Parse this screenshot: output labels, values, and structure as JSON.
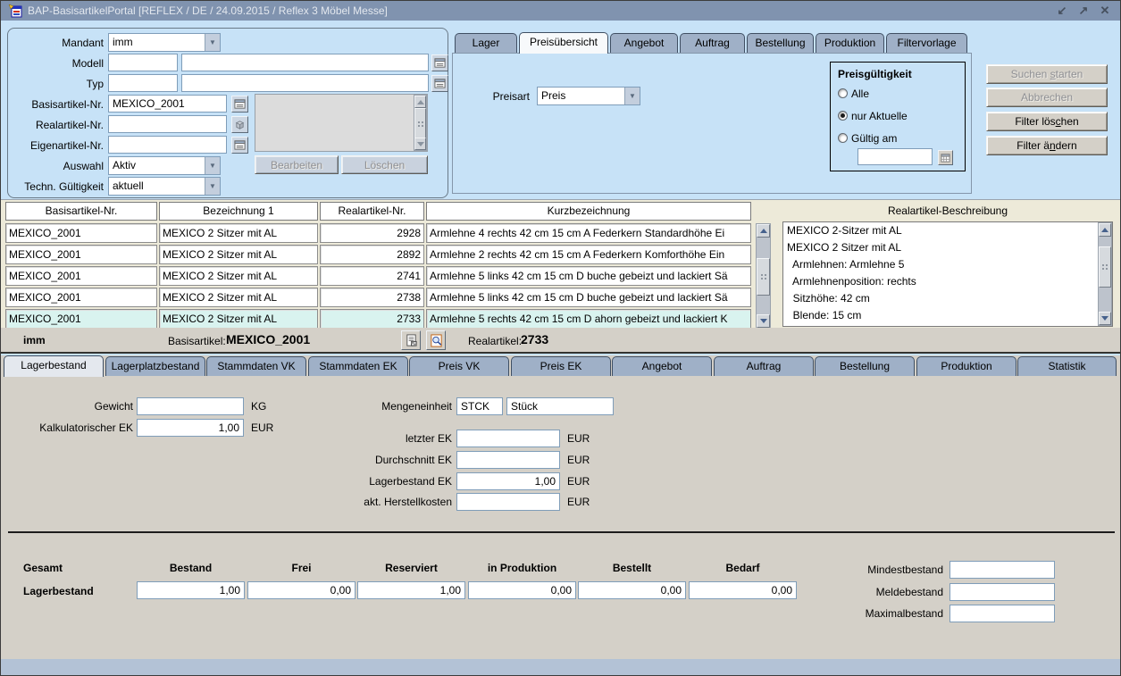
{
  "window": {
    "title": "BAP-BasisartikelPortal   [REFLEX / DE / 24.09.2015 / Reflex 3 Möbel Messe]",
    "controls": {
      "minimize": "↙",
      "restore": "↗",
      "close": "✕"
    }
  },
  "colors": {
    "titlebar": "#8093af",
    "panel_blue": "#c7e2f7",
    "panel_gray": "#d4d0c8",
    "table_bg": "#edead9",
    "selected_row": "#d9f3ef",
    "tab_inactive": "#9fb0c7",
    "input_border": "#7f9db9"
  },
  "filter": {
    "mandant_label": "Mandant",
    "mandant_value": "imm",
    "modell_label": "Modell",
    "modell_code": "",
    "modell_text": "",
    "typ_label": "Typ",
    "typ_code": "",
    "typ_text": "",
    "basisartikel_label": "Basisartikel-Nr.",
    "basisartikel_value": "MEXICO_2001",
    "realartikel_label": "Realartikel-Nr.",
    "realartikel_value": "",
    "eigenartikel_label": "Eigenartikel-Nr.",
    "eigenartikel_value": "",
    "auswahl_label": "Auswahl",
    "auswahl_value": "Aktiv",
    "gueltigkeit_label": "Techn. Gültigkeit",
    "gueltigkeit_value": "aktuell",
    "bearbeiten_label": "Bearbeiten",
    "loeschen_label": "Löschen"
  },
  "top_tabs": [
    {
      "label": "Lager",
      "active": false
    },
    {
      "label": "Preisübersicht",
      "active": true
    },
    {
      "label": "Angebot",
      "active": false
    },
    {
      "label": "Auftrag",
      "active": false
    },
    {
      "label": "Bestellung",
      "active": false
    },
    {
      "label": "Produktion",
      "active": false
    },
    {
      "label": "Filtervorlage",
      "active": false
    }
  ],
  "preis_panel": {
    "preisart_label": "Preisart",
    "preisart_value": "Preis",
    "group_title": "Preisgültigkeit",
    "radio_alle": "Alle",
    "radio_aktuelle": "nur Aktuelle",
    "radio_gueltig": "Gültig am",
    "gueltig_am_value": ""
  },
  "actions": [
    {
      "pre": "Suchen ",
      "accel": "s",
      "post": "tarten",
      "enabled": false
    },
    {
      "pre": "Abbrechen",
      "accel": "",
      "post": "",
      "enabled": false
    },
    {
      "pre": "Filter lös",
      "accel": "c",
      "post": "hen",
      "enabled": true
    },
    {
      "pre": "Filter ä",
      "accel": "n",
      "post": "dern",
      "enabled": true
    }
  ],
  "results": {
    "columns": [
      "Basisartikel-Nr.",
      "Bezeichnung 1",
      "Realartikel-Nr.",
      "Kurzbezeichnung"
    ],
    "rows": [
      [
        "MEXICO_2001",
        "MEXICO 2 Sitzer mit AL",
        "2928",
        "Armlehne 4 rechts 42 cm 15 cm A Federkern  Standardhöhe Ei"
      ],
      [
        "MEXICO_2001",
        "MEXICO 2 Sitzer mit AL",
        "2892",
        "Armlehne 2 rechts 42 cm 15 cm A Federkern  Komforthöhe Ein"
      ],
      [
        "MEXICO_2001",
        "MEXICO 2 Sitzer mit AL",
        "2741",
        "Armlehne 5 links 42 cm 15 cm D buche gebeizt und lackiert Sä"
      ],
      [
        "MEXICO_2001",
        "MEXICO 2 Sitzer mit AL",
        "2738",
        "Armlehne 5 links 42 cm 15 cm D buche gebeizt und lackiert Sä"
      ],
      [
        "MEXICO_2001",
        "MEXICO 2 Sitzer mit AL",
        "2733",
        "Armlehne 5 rechts 42 cm 15 cm D ahorn gebeizt und lackiert K"
      ]
    ],
    "selected_row": 4
  },
  "beschreibung": {
    "title": "Realartikel-Beschreibung",
    "lines": [
      "MEXICO 2-Sitzer mit AL",
      "MEXICO 2 Sitzer mit AL",
      "  Armlehnen: Armlehne 5",
      "  Armlehnenposition: rechts",
      "  Sitzhöhe: 42 cm",
      "  Blende: 15 cm"
    ]
  },
  "detail_bar": {
    "mandant": "imm",
    "basisartikel_label": "Basisartikel:",
    "basisartikel_value": "MEXICO_2001",
    "realartikel_label": "Realartikel:",
    "realartikel_value": "2733"
  },
  "detail_tabs": [
    {
      "label": "Lagerbestand",
      "active": true
    },
    {
      "label": "Lagerplatzbestand",
      "active": false
    },
    {
      "label": "Stammdaten VK",
      "active": false
    },
    {
      "label": "Stammdaten EK",
      "active": false
    },
    {
      "label": "Preis VK",
      "active": false
    },
    {
      "label": "Preis EK",
      "active": false
    },
    {
      "label": "Angebot",
      "active": false
    },
    {
      "label": "Auftrag",
      "active": false
    },
    {
      "label": "Bestellung",
      "active": false
    },
    {
      "label": "Produktion",
      "active": false
    },
    {
      "label": "Statistik",
      "active": false
    }
  ],
  "lagerbestand": {
    "gewicht_label": "Gewicht",
    "gewicht_value": "",
    "kg_unit": "KG",
    "kalk_ek_label": "Kalkulatorischer EK",
    "kalk_ek_value": "1,00",
    "eur_unit": "EUR",
    "mengeneinheit_label": "Mengeneinheit",
    "me_code": "STCK",
    "me_text": "Stück",
    "ek_rows": [
      {
        "label": "letzter EK",
        "value": ""
      },
      {
        "label": "Durchschnitt EK",
        "value": ""
      },
      {
        "label": "Lagerbestand EK",
        "value": "1,00"
      },
      {
        "label": "akt. Herstellkosten",
        "value": ""
      }
    ],
    "stock": {
      "gesamt_label": "Gesamt",
      "row_label": "Lagerbestand",
      "columns": [
        "Bestand",
        "Frei",
        "Reserviert",
        "in Produktion",
        "Bestellt",
        "Bedarf"
      ],
      "values": [
        "1,00",
        "0,00",
        "1,00",
        "0,00",
        "0,00",
        "0,00"
      ]
    },
    "limits": [
      {
        "label": "Mindestbestand",
        "value": ""
      },
      {
        "label": "Meldebestand",
        "value": ""
      },
      {
        "label": "Maximalbestand",
        "value": ""
      }
    ]
  }
}
